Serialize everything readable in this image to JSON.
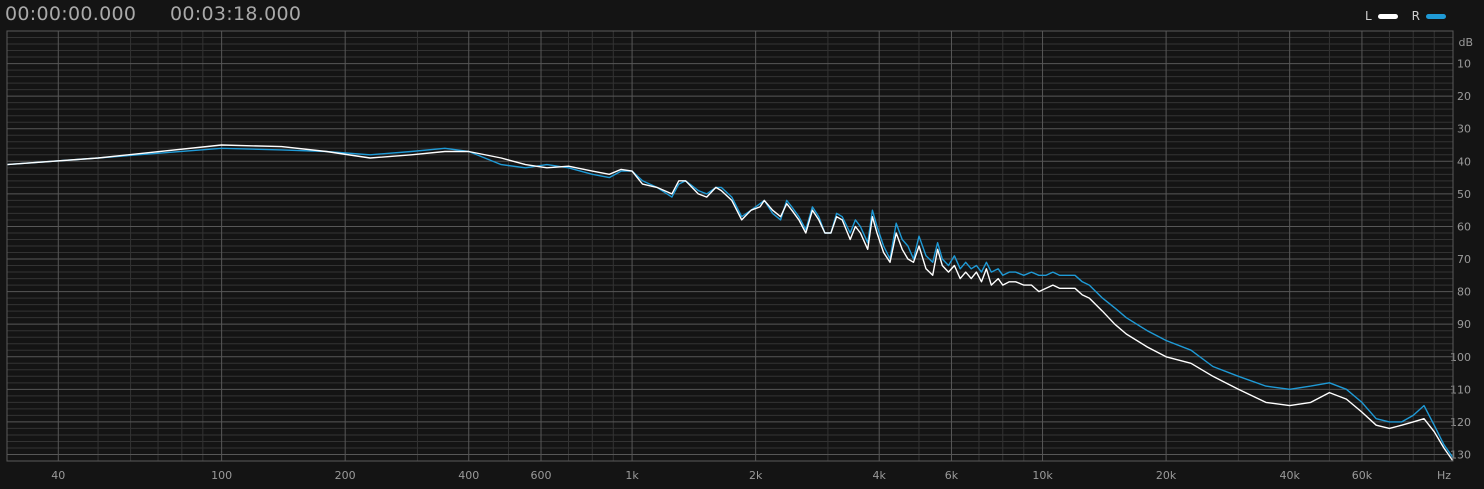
{
  "header": {
    "time_start": "00:00:00.000",
    "time_end": "00:03:18.000"
  },
  "legend": {
    "items": [
      {
        "label": "L",
        "color": "#ffffff"
      },
      {
        "label": "R",
        "color": "#1f9ad6"
      }
    ]
  },
  "chart_data": {
    "type": "line",
    "title": "",
    "xscale": "log",
    "xlabel": "Hz",
    "ylabel": "dB",
    "xlim": [
      30,
      100000
    ],
    "ylim": [
      0,
      132
    ],
    "y_inverted": true,
    "grid": true,
    "legend_position": "top-right",
    "x_ticks": [
      {
        "v": 40,
        "label": "40"
      },
      {
        "v": 100,
        "label": "100"
      },
      {
        "v": 200,
        "label": "200"
      },
      {
        "v": 400,
        "label": "400"
      },
      {
        "v": 600,
        "label": "600"
      },
      {
        "v": 1000,
        "label": "1k"
      },
      {
        "v": 2000,
        "label": "2k"
      },
      {
        "v": 4000,
        "label": "4k"
      },
      {
        "v": 6000,
        "label": "6k"
      },
      {
        "v": 10000,
        "label": "10k"
      },
      {
        "v": 20000,
        "label": "20k"
      },
      {
        "v": 40000,
        "label": "40k"
      },
      {
        "v": 60000,
        "label": "60k"
      }
    ],
    "y_ticks": [
      10,
      20,
      30,
      40,
      50,
      60,
      70,
      80,
      90,
      100,
      110,
      120,
      130
    ],
    "series": [
      {
        "name": "L",
        "color": "#ffffff",
        "points": [
          [
            30,
            41
          ],
          [
            50,
            39
          ],
          [
            100,
            35
          ],
          [
            140,
            35.5
          ],
          [
            180,
            37
          ],
          [
            230,
            39
          ],
          [
            290,
            38
          ],
          [
            350,
            37
          ],
          [
            400,
            37
          ],
          [
            480,
            39
          ],
          [
            550,
            41
          ],
          [
            620,
            42
          ],
          [
            700,
            41.5
          ],
          [
            800,
            43
          ],
          [
            880,
            44
          ],
          [
            940,
            42.5
          ],
          [
            1000,
            43
          ],
          [
            1060,
            47
          ],
          [
            1150,
            48
          ],
          [
            1250,
            50
          ],
          [
            1300,
            46
          ],
          [
            1350,
            46
          ],
          [
            1450,
            50
          ],
          [
            1520,
            51
          ],
          [
            1600,
            48
          ],
          [
            1650,
            49
          ],
          [
            1750,
            52
          ],
          [
            1850,
            58
          ],
          [
            1950,
            55
          ],
          [
            2050,
            54
          ],
          [
            2100,
            52
          ],
          [
            2200,
            55
          ],
          [
            2300,
            57
          ],
          [
            2380,
            53
          ],
          [
            2450,
            55
          ],
          [
            2550,
            58
          ],
          [
            2650,
            62
          ],
          [
            2750,
            55
          ],
          [
            2850,
            58
          ],
          [
            2950,
            62
          ],
          [
            3050,
            62
          ],
          [
            3150,
            57
          ],
          [
            3250,
            58
          ],
          [
            3400,
            64
          ],
          [
            3500,
            60
          ],
          [
            3600,
            62
          ],
          [
            3750,
            67
          ],
          [
            3850,
            57
          ],
          [
            3950,
            62
          ],
          [
            4100,
            68
          ],
          [
            4250,
            71
          ],
          [
            4400,
            62
          ],
          [
            4550,
            67
          ],
          [
            4700,
            70
          ],
          [
            4850,
            71
          ],
          [
            5000,
            66
          ],
          [
            5200,
            73
          ],
          [
            5400,
            75
          ],
          [
            5550,
            67
          ],
          [
            5700,
            72
          ],
          [
            5900,
            74
          ],
          [
            6100,
            72
          ],
          [
            6300,
            76
          ],
          [
            6500,
            74
          ],
          [
            6700,
            76
          ],
          [
            6900,
            74
          ],
          [
            7100,
            77
          ],
          [
            7300,
            73
          ],
          [
            7500,
            78
          ],
          [
            7800,
            76
          ],
          [
            8000,
            78
          ],
          [
            8300,
            77
          ],
          [
            8600,
            77
          ],
          [
            9000,
            78
          ],
          [
            9400,
            78
          ],
          [
            9800,
            80
          ],
          [
            10200,
            79
          ],
          [
            10600,
            78
          ],
          [
            11000,
            79
          ],
          [
            11500,
            79
          ],
          [
            12000,
            79
          ],
          [
            12500,
            81
          ],
          [
            13000,
            82
          ],
          [
            14000,
            86
          ],
          [
            15000,
            90
          ],
          [
            16000,
            93
          ],
          [
            18000,
            97
          ],
          [
            20000,
            100
          ],
          [
            23000,
            102
          ],
          [
            26000,
            106
          ],
          [
            30000,
            110
          ],
          [
            35000,
            114
          ],
          [
            40000,
            115
          ],
          [
            45000,
            114
          ],
          [
            50000,
            111
          ],
          [
            55000,
            113
          ],
          [
            60000,
            117
          ],
          [
            65000,
            121
          ],
          [
            70000,
            122
          ],
          [
            75000,
            121
          ],
          [
            80000,
            120
          ],
          [
            85000,
            119
          ],
          [
            90000,
            123
          ],
          [
            95000,
            128
          ],
          [
            100000,
            132
          ]
        ]
      },
      {
        "name": "R",
        "color": "#1f9ad6",
        "points": [
          [
            30,
            41
          ],
          [
            50,
            39
          ],
          [
            100,
            36
          ],
          [
            140,
            36.5
          ],
          [
            180,
            37
          ],
          [
            230,
            38
          ],
          [
            290,
            37
          ],
          [
            350,
            36
          ],
          [
            400,
            37
          ],
          [
            480,
            41
          ],
          [
            550,
            42
          ],
          [
            620,
            41
          ],
          [
            700,
            42
          ],
          [
            800,
            44
          ],
          [
            880,
            45
          ],
          [
            940,
            43
          ],
          [
            1000,
            43
          ],
          [
            1060,
            46
          ],
          [
            1150,
            48
          ],
          [
            1250,
            51
          ],
          [
            1300,
            47
          ],
          [
            1350,
            46
          ],
          [
            1450,
            49
          ],
          [
            1520,
            50
          ],
          [
            1600,
            48
          ],
          [
            1650,
            48
          ],
          [
            1750,
            51
          ],
          [
            1850,
            57
          ],
          [
            1950,
            55
          ],
          [
            2050,
            53
          ],
          [
            2100,
            52
          ],
          [
            2200,
            56
          ],
          [
            2300,
            58
          ],
          [
            2380,
            52
          ],
          [
            2450,
            54
          ],
          [
            2550,
            57
          ],
          [
            2650,
            61
          ],
          [
            2750,
            54
          ],
          [
            2850,
            57
          ],
          [
            2950,
            62
          ],
          [
            3050,
            62
          ],
          [
            3150,
            56
          ],
          [
            3250,
            57
          ],
          [
            3400,
            62
          ],
          [
            3500,
            58
          ],
          [
            3600,
            60
          ],
          [
            3750,
            65
          ],
          [
            3850,
            55
          ],
          [
            3950,
            60
          ],
          [
            4100,
            66
          ],
          [
            4250,
            70
          ],
          [
            4400,
            59
          ],
          [
            4550,
            64
          ],
          [
            4700,
            66
          ],
          [
            4850,
            70
          ],
          [
            5000,
            63
          ],
          [
            5200,
            69
          ],
          [
            5400,
            71
          ],
          [
            5550,
            65
          ],
          [
            5700,
            70
          ],
          [
            5900,
            72
          ],
          [
            6100,
            69
          ],
          [
            6300,
            73
          ],
          [
            6500,
            71
          ],
          [
            6700,
            73
          ],
          [
            6900,
            72
          ],
          [
            7100,
            74
          ],
          [
            7300,
            71
          ],
          [
            7500,
            74
          ],
          [
            7800,
            73
          ],
          [
            8000,
            75
          ],
          [
            8300,
            74
          ],
          [
            8600,
            74
          ],
          [
            9000,
            75
          ],
          [
            9400,
            74
          ],
          [
            9800,
            75
          ],
          [
            10200,
            75
          ],
          [
            10600,
            74
          ],
          [
            11000,
            75
          ],
          [
            11500,
            75
          ],
          [
            12000,
            75
          ],
          [
            12500,
            77
          ],
          [
            13000,
            78
          ],
          [
            14000,
            82
          ],
          [
            15000,
            85
          ],
          [
            16000,
            88
          ],
          [
            18000,
            92
          ],
          [
            20000,
            95
          ],
          [
            23000,
            98
          ],
          [
            26000,
            103
          ],
          [
            30000,
            106
          ],
          [
            35000,
            109
          ],
          [
            40000,
            110
          ],
          [
            45000,
            109
          ],
          [
            50000,
            108
          ],
          [
            55000,
            110
          ],
          [
            60000,
            114
          ],
          [
            65000,
            119
          ],
          [
            70000,
            120
          ],
          [
            75000,
            120
          ],
          [
            80000,
            118
          ],
          [
            85000,
            115
          ],
          [
            90000,
            121
          ],
          [
            95000,
            127
          ],
          [
            100000,
            131
          ]
        ]
      }
    ]
  }
}
